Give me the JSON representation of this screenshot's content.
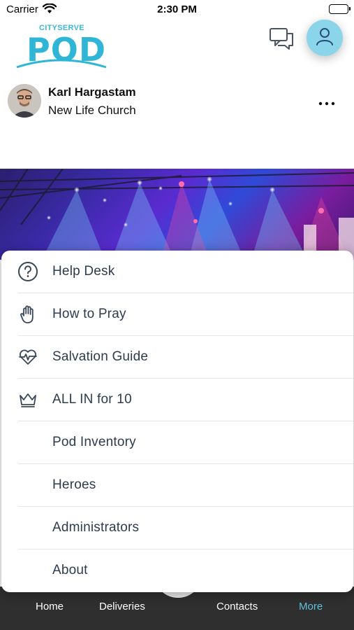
{
  "status_bar": {
    "carrier": "Carrier",
    "time": "2:30 PM"
  },
  "header": {
    "logo_top": "CITYSERVE",
    "logo_main": "POD"
  },
  "post": {
    "author": "Karl Hargastam",
    "church": "New Life Church"
  },
  "menu": {
    "items": [
      {
        "label": "Help Desk",
        "icon": "help-circle-icon"
      },
      {
        "label": "How to Pray",
        "icon": "praying-hand-icon"
      },
      {
        "label": "Salvation Guide",
        "icon": "heart-pulse-icon"
      },
      {
        "label": "ALL IN for 10",
        "icon": "crown-icon"
      },
      {
        "label": "Pod Inventory",
        "icon": ""
      },
      {
        "label": "Heroes",
        "icon": ""
      },
      {
        "label": "Administrators",
        "icon": ""
      },
      {
        "label": "About",
        "icon": ""
      }
    ]
  },
  "tab_bar": {
    "tabs": [
      {
        "label": "Home"
      },
      {
        "label": "Deliveries"
      },
      {
        "label": "Contacts"
      },
      {
        "label": "More",
        "active": true
      }
    ],
    "active_color": "#5fc2e0"
  },
  "colors": {
    "accent": "#2fb6d6",
    "profile_button": "#8ad5ea",
    "tab_bar": "#2f2f2f"
  }
}
